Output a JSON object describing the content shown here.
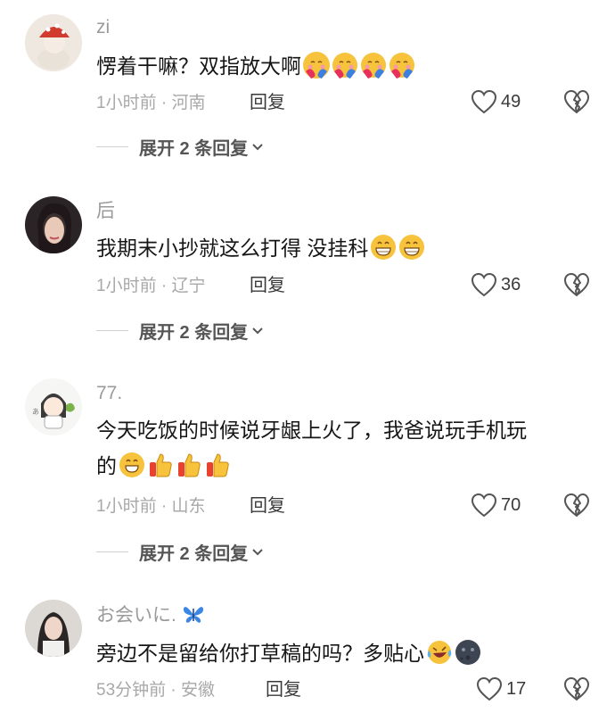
{
  "comments": [
    {
      "username": "zi",
      "text": "愣着干嘛？双指放大啊",
      "text_line2": "",
      "emojis": [
        "hugging-face",
        "hugging-face",
        "hugging-face",
        "hugging-face"
      ],
      "emojis_line2": [],
      "time": "1小时前",
      "location": "河南",
      "reply_label": "回复",
      "likes": "49",
      "expand_label": "展开 2 条回复"
    },
    {
      "username": "后",
      "text": "我期末小抄就这么打得 没挂科",
      "text_line2": "",
      "emojis": [
        "grinning-face",
        "grinning-face"
      ],
      "emojis_line2": [],
      "time": "1小时前",
      "location": "辽宁",
      "reply_label": "回复",
      "likes": "36",
      "expand_label": "展开 2 条回复"
    },
    {
      "username": "77.",
      "text": "今天吃饭的时候说牙龈上火了，我爸说玩手机玩",
      "text_line2": "的",
      "emojis": [],
      "emojis_line2": [
        "grinning-face",
        "thumbs-up",
        "thumbs-up",
        "thumbs-up"
      ],
      "time": "1小时前",
      "location": "山东",
      "reply_label": "回复",
      "likes": "70",
      "expand_label": "展开 2 条回复"
    },
    {
      "username": "お会いに.",
      "username_emoji": "butterfly",
      "text": "旁边不是留给你打草稿的吗？多贴心",
      "text_line2": "",
      "emojis": [
        "laughing-tears",
        "dark-moon-face"
      ],
      "emojis_line2": [],
      "time": "53分钟前",
      "location": "安徽",
      "reply_label": "回复",
      "likes": "17",
      "expand_label": ""
    }
  ],
  "meta_separator": " · ",
  "colors": {
    "text": "#161616",
    "muted": "#a8a8a8",
    "emoji_yellow": "#f7c23c",
    "heart_stroke": "#555555"
  }
}
